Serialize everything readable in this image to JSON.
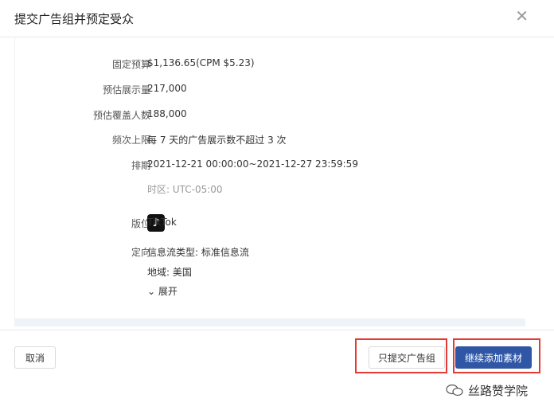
{
  "dialog": {
    "title": "提交广告组并预定受众",
    "close_icon": "close-icon"
  },
  "details": {
    "budget": {
      "label": "固定预算",
      "value": "$1,136.65(CPM $5.23)"
    },
    "impressions": {
      "label": "预估展示量",
      "value": "217,000"
    },
    "reach": {
      "label": "预估覆盖人数",
      "value": "188,000"
    },
    "frequency": {
      "label": "频次上限",
      "value": "每 7 天的广告展示数不超过 3 次"
    },
    "schedule": {
      "label": "排期",
      "value": "2021-12-21 00:00:00~2021-12-27 23:59:59",
      "timezone": "时区: UTC-05:00"
    },
    "placement": {
      "label": "版位",
      "value": "TikTok",
      "icon": "tiktok-icon"
    },
    "targeting": {
      "label": "定向",
      "feed_type": "信息流类型: 标准信息流",
      "region": "地域: 美国",
      "expand_label": "展开"
    }
  },
  "footer": {
    "cancel_label": "取消",
    "submit_only_label": "只提交广告组",
    "continue_label": "继续添加素材",
    "accent": "#2f57a6",
    "highlight_color": "#e53935"
  },
  "watermark": {
    "text": "丝路赞学院"
  }
}
